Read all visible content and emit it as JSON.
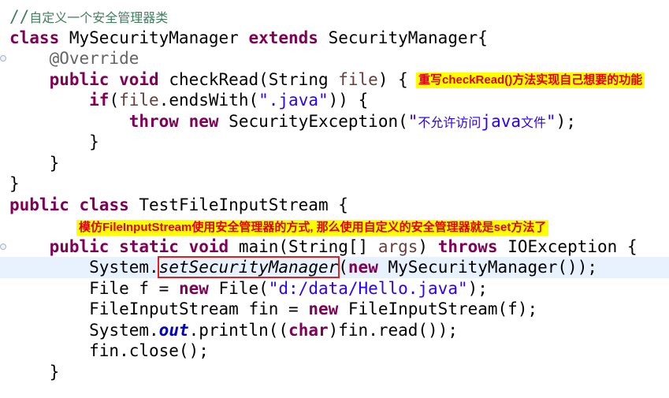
{
  "code": {
    "l1_comment_prefix": "//",
    "l1_comment_text": "自定义一个安全管理器类",
    "l2_class": "class",
    "l2_name": " MySecurityManager ",
    "l2_extends": "extends",
    "l2_super": " SecurityManager{",
    "l3_indent": "    ",
    "l3_annotation": "@Override",
    "l4_indent": "    ",
    "l4_public": "public",
    "l4_void": "void",
    "l4_sig_a": " checkRead(String ",
    "l4_param": "file",
    "l4_sig_b": ") {",
    "l5_indent": "        ",
    "l5_if": "if",
    "l5_a": "(",
    "l5_param": "file",
    "l5_b": ".endsWith(",
    "l5_str": "\".java\"",
    "l5_c": ")) {",
    "l6_indent": "            ",
    "l6_throw": "throw",
    "l6_new": "new",
    "l6_a": " SecurityException(",
    "l6_q1": "\"",
    "l6_zh1": "不允许访问",
    "l6_java": "java",
    "l6_zh2": "文件",
    "l6_q2": "\"",
    "l6_b": ");",
    "l7": "        }",
    "l8": "    }",
    "l9": "}",
    "l10_public": "public",
    "l10_class": "class",
    "l10_name": " TestFileInputStream {",
    "l11_indent": "    ",
    "l11_public": "public",
    "l11_static": "static",
    "l11_void": "void",
    "l11_a": " main(String[] ",
    "l11_param": "args",
    "l11_b": ") ",
    "l11_throws": "throws",
    "l11_c": " IOException {",
    "l12_indent": "        ",
    "l12_a": "System.",
    "l12_method": "setSecurityManager",
    "l12_b": "(",
    "l12_new": "new",
    "l12_c": " MySecurityManager());",
    "l13_indent": "        ",
    "l13_a": "File f = ",
    "l13_new": "new",
    "l13_b": " File(",
    "l13_str": "\"d:/data/Hello.java\"",
    "l13_c": ");",
    "l14_indent": "        ",
    "l14_a": "FileInputStream fin = ",
    "l14_new": "new",
    "l14_b": " FileInputStream(f);",
    "l15_indent": "        ",
    "l15_a": "System.",
    "l15_field": "out",
    "l15_b": ".println((",
    "l15_char": "char",
    "l15_c": ")fin.read());",
    "l16": "        fin.close();",
    "l17": "    }"
  },
  "annotations": {
    "callout1": "重写checkRead()方法实现自己想要的功能",
    "callout2": "模仿FileInputStream使用安全管理器的方式, 那么使用自定义的安全管理器就是set方法了"
  },
  "colors": {
    "keyword": "#7f0055",
    "comment": "#3f7f5f",
    "string": "#2a00ff",
    "annotation": "#646464",
    "callout_bg": "#ffff00",
    "callout_text": "#e00000",
    "highlight_box": "#e02020"
  }
}
